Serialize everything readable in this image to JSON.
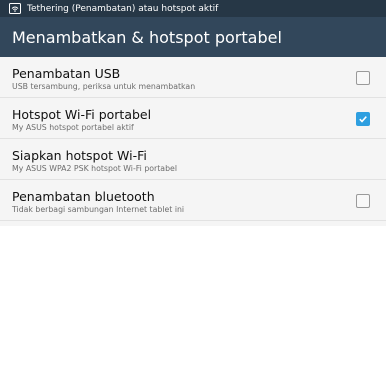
{
  "status_bar": {
    "icon": "hotspot-icon",
    "text": "Tethering (Penambatan) atau hotspot aktif"
  },
  "action_bar": {
    "title": "Menambatkan & hotspot portabel"
  },
  "items": [
    {
      "label": "Penambatan USB",
      "sub": "USB tersambung, periksa untuk menambatkan",
      "checkbox": true,
      "checked": false
    },
    {
      "label": "Hotspot Wi-Fi portabel",
      "sub": "My ASUS hotspot portabel aktif",
      "checkbox": true,
      "checked": true
    },
    {
      "label": "Siapkan hotspot Wi-Fi",
      "sub": "My ASUS WPA2 PSK hotspot Wi-Fi portabel",
      "checkbox": false
    },
    {
      "label": "Penambatan bluetooth",
      "sub": "Tidak berbagi sambungan Internet tablet ini",
      "checkbox": true,
      "checked": false
    }
  ],
  "colors": {
    "status_bar": "#263746",
    "action_bar": "#32475b",
    "accent": "#2e9fe0"
  }
}
